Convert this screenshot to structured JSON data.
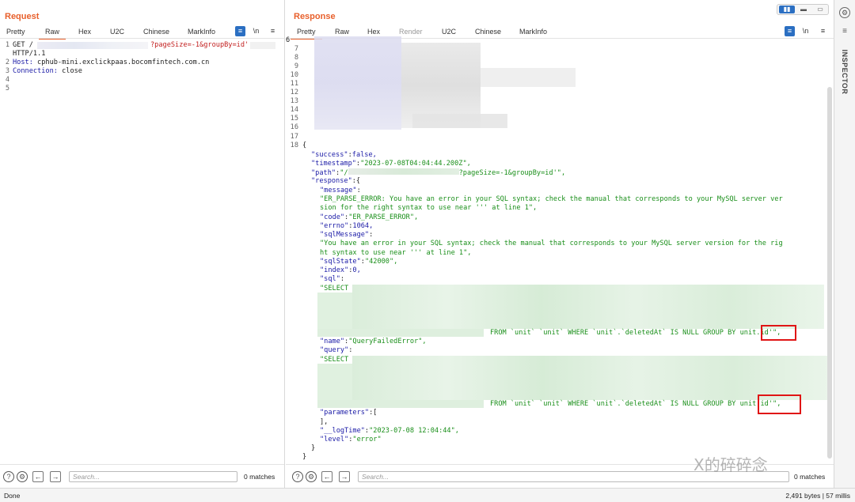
{
  "request": {
    "title": "Request",
    "tabs": [
      "Pretty",
      "Raw",
      "Hex",
      "U2C",
      "Chinese",
      "MarkInfo"
    ],
    "active_tab": "Raw",
    "lines": [
      {
        "n": "1",
        "a": "GET /",
        "b": "?pageSize=-1&groupBy=id'"
      },
      {
        "n": "",
        "a": "HTTP/1.1",
        "b": ""
      },
      {
        "n": "2",
        "a": "Host:",
        "b": " cphub-mini.exclickpaas.bocomfintech.com.cn"
      },
      {
        "n": "3",
        "a": "Connection:",
        "b": " close"
      },
      {
        "n": "4",
        "a": "",
        "b": ""
      },
      {
        "n": "5",
        "a": "",
        "b": ""
      }
    ],
    "search_placeholder": "Search...",
    "matches": "0 matches"
  },
  "response": {
    "title": "Response",
    "tabs": [
      "Pretty",
      "Raw",
      "Hex",
      "Render",
      "U2C",
      "Chinese",
      "MarkInfo"
    ],
    "active_tab": "Pretty",
    "line_numbers": [
      "6",
      "7",
      "8",
      "9",
      "10",
      "11",
      "12",
      "13",
      "14",
      "15",
      "16",
      "17",
      "18"
    ],
    "body": {
      "open": "{",
      "success_key": "\"success\"",
      "success_val": "false,",
      "timestamp_key": "\"timestamp\"",
      "timestamp_val": "\"2023-07-08T04:04:44.200Z\",",
      "path_key": "\"path\"",
      "path_val_a": "\"/",
      "path_val_b": "?pageSize=-1&groupBy=id'\",",
      "response_key": "\"response\"",
      "response_open": ":{",
      "message_key": "\"message\"",
      "message_line1": "\"ER_PARSE_ERROR: You have an error in your SQL syntax; check the manual that corresponds to your MySQL server ver",
      "message_line2": "sion for the right syntax to use near ''' at line 1\",",
      "code_key": "\"code\"",
      "code_val": "\"ER_PARSE_ERROR\",",
      "errno_key": "\"errno\"",
      "errno_val": "1064,",
      "sqlmessage_key": "\"sqlMessage\"",
      "sqlmessage_line1": "\"You have an error in your SQL syntax; check the manual that corresponds to your MySQL server version for the rig",
      "sqlmessage_line2": "ht syntax to use near ''' at line 1\",",
      "sqlstate_key": "\"sqlState\"",
      "sqlstate_val": "\"42000\",",
      "index_key": "\"index\"",
      "index_val": "0,",
      "sql_key": "\"sql\"",
      "sql_start": "\"SELECT",
      "sql_tail_a": "FROM `unit` `unit` WHERE `unit`.`deletedAt` IS NULL GROUP BY ",
      "sql_tail_b": "unit.id",
      "sql_tail_c": "'\",",
      "name_key": "\"name\"",
      "name_val": "\"QueryFailedError\",",
      "query_key": "\"query\"",
      "query_start": "\"SELECT",
      "query_tail_a": "FROM `unit` `unit` WHERE `unit`.`deletedAt` IS NULL GROUP BY ",
      "query_tail_b": "unit.id'",
      "query_tail_c": "\",",
      "parameters_key": "\"parameters\"",
      "parameters_open": ":[",
      "parameters_close": "],",
      "logtime_key": "\"__logTime\"",
      "logtime_val": "\"2023-07-08 12:04:44\",",
      "level_key": "\"level\"",
      "level_val": "\"error\"",
      "inner_close": "}",
      "outer_close": "}"
    },
    "search_placeholder": "Search...",
    "matches": "0 matches"
  },
  "inspector": {
    "label": "INSPECTOR"
  },
  "status": {
    "left": "Done",
    "right": "2,491 bytes | 57 millis"
  },
  "watermark": "X的碎碎念",
  "colors": {
    "accent": "#e8602c",
    "blue": "#2b6fc2",
    "highlight": "#e01515"
  }
}
